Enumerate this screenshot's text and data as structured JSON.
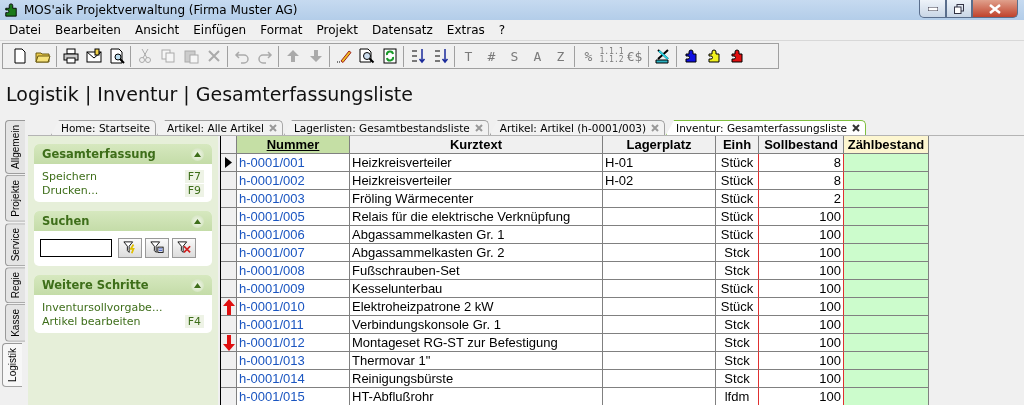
{
  "window": {
    "title": "MOS'aik Projektverwaltung (Firma Muster AG)"
  },
  "menu": [
    "Datei",
    "Bearbeiten",
    "Ansicht",
    "Einfügen",
    "Format",
    "Projekt",
    "Datensatz",
    "Extras",
    "?"
  ],
  "toolbar": [
    [
      {
        "disabled": false
      },
      {
        "disabled": false
      }
    ],
    [
      {
        "disabled": false
      },
      {
        "disabled": false
      },
      {
        "disabled": false
      }
    ],
    [
      {
        "disabled": true
      },
      {
        "disabled": true
      },
      {
        "disabled": true
      },
      {
        "disabled": true
      }
    ],
    [
      {
        "disabled": true
      },
      {
        "disabled": true
      }
    ],
    [
      {
        "disabled": true
      },
      {
        "disabled": true
      }
    ],
    [
      {
        "disabled": false
      },
      {
        "disabled": false
      },
      {
        "disabled": false
      }
    ],
    [
      {
        "disabled": false
      },
      {
        "disabled": false
      }
    ],
    [
      {
        "label": "T",
        "disabled": true
      },
      {
        "label": "#",
        "disabled": true
      },
      {
        "label": "S",
        "disabled": true
      },
      {
        "label": "A",
        "disabled": true
      },
      {
        "label": "Z",
        "disabled": true
      }
    ],
    [
      {
        "label": "%",
        "disabled": true
      },
      {
        "label": "1.1.1 1.1.2",
        "disabled": true
      },
      {
        "label": "€$",
        "disabled": true
      }
    ],
    [
      {
        "disabled": false
      }
    ],
    [
      {
        "disabled": false
      },
      {
        "disabled": false
      },
      {
        "disabled": false
      }
    ]
  ],
  "page_title": "Logistik | Inventur | Gesamterfassungsliste",
  "side_tabs": [
    {
      "label": "Allgemein",
      "selected": false
    },
    {
      "label": "Projekte",
      "selected": false
    },
    {
      "label": "Service",
      "selected": false
    },
    {
      "label": "Regie",
      "selected": false
    },
    {
      "label": "Kasse",
      "selected": false
    },
    {
      "label": "Logistik",
      "selected": true
    }
  ],
  "doc_tabs": [
    {
      "label": "Home: Startseite",
      "closable": false,
      "selected": false
    },
    {
      "label": "Artikel: Alle Artikel",
      "closable": true,
      "selected": false
    },
    {
      "label": "Lagerlisten: Gesamtbestandsliste",
      "closable": true,
      "selected": false
    },
    {
      "label": "Artikel: Artikel (h-0001/003)",
      "closable": true,
      "selected": false
    },
    {
      "label": "Inventur: Gesamterfassungsliste",
      "closable": true,
      "selected": true
    }
  ],
  "sidebar": {
    "panels": [
      {
        "kind": "actions",
        "title": "Gesamterfassung",
        "expanded": true,
        "items": [
          {
            "label": "Speichern",
            "shortcut": "F7"
          },
          {
            "label": "Drucken...",
            "shortcut": "F9"
          }
        ]
      },
      {
        "kind": "search",
        "title": "Suchen",
        "expanded": true
      },
      {
        "kind": "actions",
        "title": "Weitere Schritte",
        "expanded": true,
        "items": [
          {
            "label": "Inventursollvorgabe..."
          },
          {
            "label": "Artikel bearbeiten",
            "shortcut": "F4"
          }
        ]
      }
    ]
  },
  "table": {
    "columns": [
      "Nummer",
      "Kurztext",
      "Lagerplatz",
      "Einh",
      "Sollbestand",
      "Zählbestand"
    ],
    "rows": [
      {
        "kind": "current",
        "cells": [
          "h-0001/001",
          "Heizkreisverteiler",
          "H-01",
          "Stück",
          "8"
        ]
      },
      {
        "cells": [
          "h-0001/002",
          "Heizkreisverteiler",
          "H-02",
          "Stück",
          "8"
        ]
      },
      {
        "cells": [
          "h-0001/003",
          "Fröling Wärmecenter",
          "",
          "Stück",
          "2"
        ]
      },
      {
        "cells": [
          "h-0001/005",
          "Relais für die elektrische Verknüpfung",
          "",
          "Stück",
          "100"
        ]
      },
      {
        "cells": [
          "h-0001/006",
          "Abgassammelkasten Gr. 1",
          "",
          "Stück",
          "100"
        ]
      },
      {
        "cells": [
          "h-0001/007",
          "Abgassammelkasten Gr. 2",
          "",
          "Stck",
          "100"
        ]
      },
      {
        "cells": [
          "h-0001/008",
          "Fußschrauben-Set",
          "",
          "Stck",
          "100"
        ]
      },
      {
        "cells": [
          "h-0001/009",
          "Kesselunterbau",
          "",
          "Stück",
          "100"
        ]
      },
      {
        "kind": "up",
        "cells": [
          "h-0001/010",
          "Elektroheizpatrone 2 kW",
          "",
          "Stück",
          "100"
        ]
      },
      {
        "cells": [
          "h-0001/011",
          "Verbindungskonsole Gr. 1",
          "",
          "Stck",
          "100"
        ]
      },
      {
        "kind": "down",
        "cells": [
          "h-0001/012",
          "Montageset RG-ST zur Befestigung",
          "",
          "Stck",
          "100"
        ]
      },
      {
        "cells": [
          "h-0001/013",
          "Thermovar 1\"",
          "",
          "Stck",
          "100"
        ]
      },
      {
        "cells": [
          "h-0001/014",
          "Reinigungsbürste",
          "",
          "Stck",
          "100"
        ]
      },
      {
        "cells": [
          "h-0001/015",
          "HT-Abflußrohr",
          "",
          "lfdm",
          "100"
        ]
      }
    ]
  }
}
